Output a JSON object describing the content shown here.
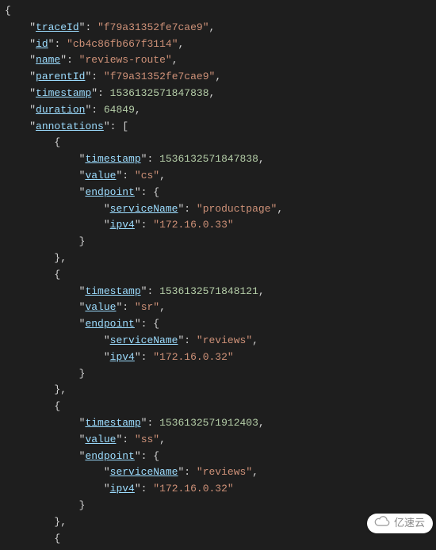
{
  "code": {
    "traceId_key": "traceId",
    "traceId_val": "f79a31352fe7cae9",
    "id_key": "id",
    "id_val": "cb4c86fb667f3114",
    "name_key": "name",
    "name_val": "reviews-route",
    "parentId_key": "parentId",
    "parentId_val": "f79a31352fe7cae9",
    "timestamp_key": "timestamp",
    "timestamp_val": "1536132571847838",
    "duration_key": "duration",
    "duration_val": "64849",
    "annotations_key": "annotations",
    "ann": [
      {
        "timestamp_key": "timestamp",
        "timestamp_val": "1536132571847838",
        "value_key": "value",
        "value_val": "cs",
        "endpoint_key": "endpoint",
        "serviceName_key": "serviceName",
        "serviceName_val": "productpage",
        "ipv4_key": "ipv4",
        "ipv4_val": "172.16.0.33"
      },
      {
        "timestamp_key": "timestamp",
        "timestamp_val": "1536132571848121",
        "value_key": "value",
        "value_val": "sr",
        "endpoint_key": "endpoint",
        "serviceName_key": "serviceName",
        "serviceName_val": "reviews",
        "ipv4_key": "ipv4",
        "ipv4_val": "172.16.0.32"
      },
      {
        "timestamp_key": "timestamp",
        "timestamp_val": "1536132571912403",
        "value_key": "value",
        "value_val": "ss",
        "endpoint_key": "endpoint",
        "serviceName_key": "serviceName",
        "serviceName_val": "reviews",
        "ipv4_key": "ipv4",
        "ipv4_val": "172.16.0.32"
      }
    ]
  },
  "watermark": "亿速云"
}
